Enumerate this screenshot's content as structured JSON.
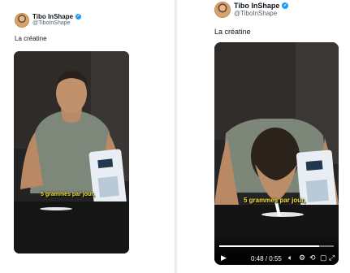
{
  "left": {
    "display_name": "Tibo InShape",
    "handle": "@TiboInShape",
    "tweet_text": "La créatine",
    "subtitle": "5 grammes par jour,"
  },
  "right": {
    "display_name": "Tibo InShape",
    "handle": "@TiboInShape",
    "tweet_text": "La créatine",
    "subtitle": "5 grammes par jour,",
    "player": {
      "current_time": "0:48",
      "duration": "0:55",
      "time_separator": "/",
      "progress": 0.87
    }
  },
  "icons": {
    "verified": "verified-badge-icon",
    "play": "play-icon",
    "volume": "volume-icon",
    "settings": "settings-icon",
    "captions": "captions-icon",
    "loop": "loop-icon",
    "fullscreen": "fullscreen-icon"
  },
  "colors": {
    "verified_blue": "#1d9bf0",
    "subtitle_yellow": "#f4e332",
    "handle_gray": "#536471"
  }
}
